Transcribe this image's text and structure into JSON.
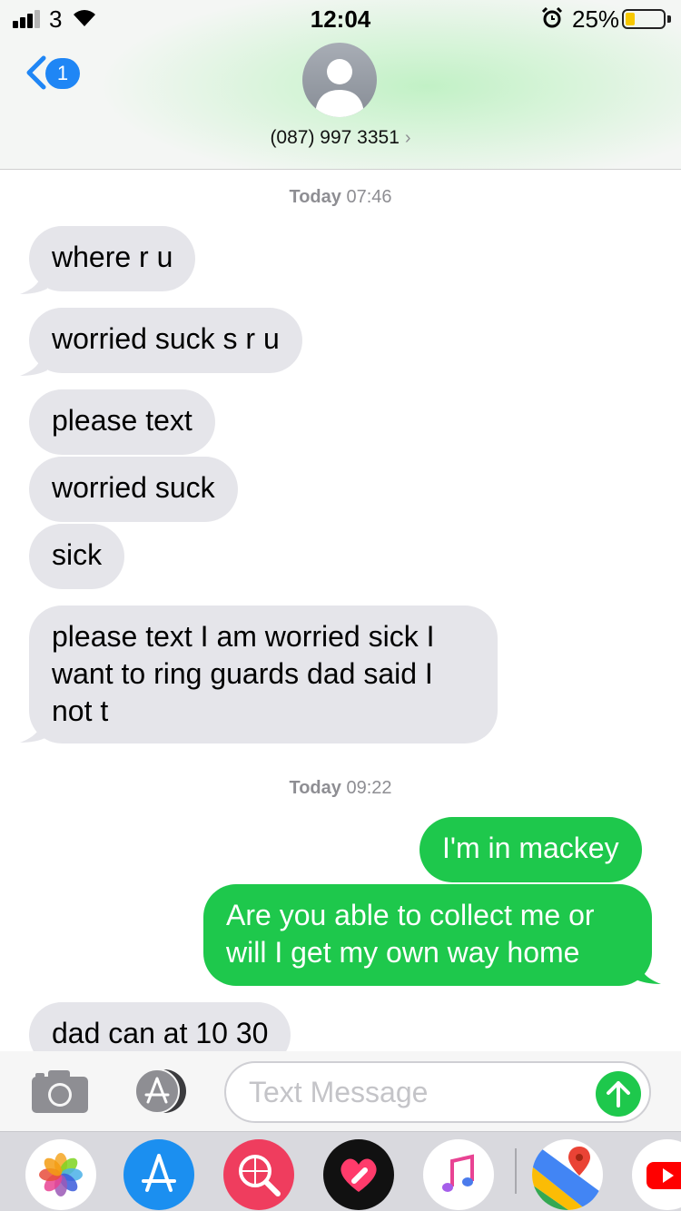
{
  "status_bar": {
    "carrier": "3",
    "time": "12:04",
    "battery_percent": "25%",
    "battery_level": 0.25
  },
  "header": {
    "back_badge": "1",
    "contact": "(087) 997 3351",
    "chevron": "›"
  },
  "conversation": {
    "timestamps": [
      {
        "day": "Today",
        "time": "07:46"
      },
      {
        "day": "Today",
        "time": "09:22"
      }
    ],
    "messages": [
      {
        "direction": "in",
        "text": "where r u"
      },
      {
        "direction": "in",
        "text": "worried suck s r u"
      },
      {
        "direction": "in",
        "text": "please text"
      },
      {
        "direction": "in",
        "text": "worried suck"
      },
      {
        "direction": "in",
        "text": "sick"
      },
      {
        "direction": "in",
        "lines": [
          "please text I am worried sick  I",
          "want to ring guards dad said I",
          "not t"
        ]
      },
      {
        "direction": "out",
        "text": "I'm in mackey"
      },
      {
        "direction": "out",
        "lines": [
          "Are you able to collect me or",
          "will I get my own way home"
        ]
      },
      {
        "direction": "in",
        "text": "dad can at 10 30"
      }
    ]
  },
  "input_bar": {
    "placeholder": "Text Message",
    "icons": [
      "camera-icon",
      "app-store-icon",
      "send-arrow-icon"
    ]
  },
  "app_drawer": {
    "icons": [
      "photos-icon",
      "app-store-icon",
      "web-search-icon",
      "digital-touch-icon",
      "music-icon",
      "maps-icon",
      "youtube-icon"
    ]
  },
  "colors": {
    "incoming_bubble": "#e5e5ea",
    "outgoing_bubble": "#1ec84c",
    "accent_blue": "#1f86f5",
    "timestamp_gray": "#8e8e93"
  }
}
